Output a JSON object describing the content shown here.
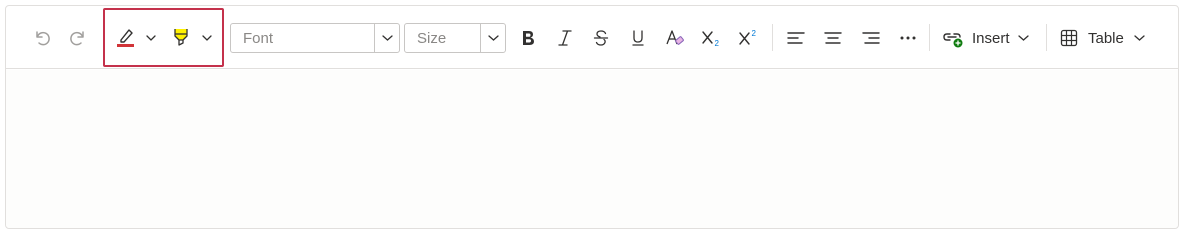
{
  "toolbar": {
    "font_placeholder": "Font",
    "size_placeholder": "Size",
    "insert_label": "Insert",
    "table_label": "Table",
    "font_color": "#d13438",
    "highlight_color": "#fff100"
  },
  "colors": {
    "highlight_frame": "#c4314b",
    "icon": "#323130",
    "disabled_icon": "#a19f9d",
    "border": "#e1dfdd"
  },
  "icons": [
    "undo-icon",
    "redo-icon",
    "font-color-icon",
    "highlight-icon",
    "bold-icon",
    "italic-icon",
    "strikethrough-icon",
    "underline-icon",
    "clear-format-icon",
    "subscript-icon",
    "superscript-icon",
    "align-left-icon",
    "align-center-icon",
    "align-right-icon",
    "more-icon",
    "insert-link-icon",
    "table-icon"
  ]
}
